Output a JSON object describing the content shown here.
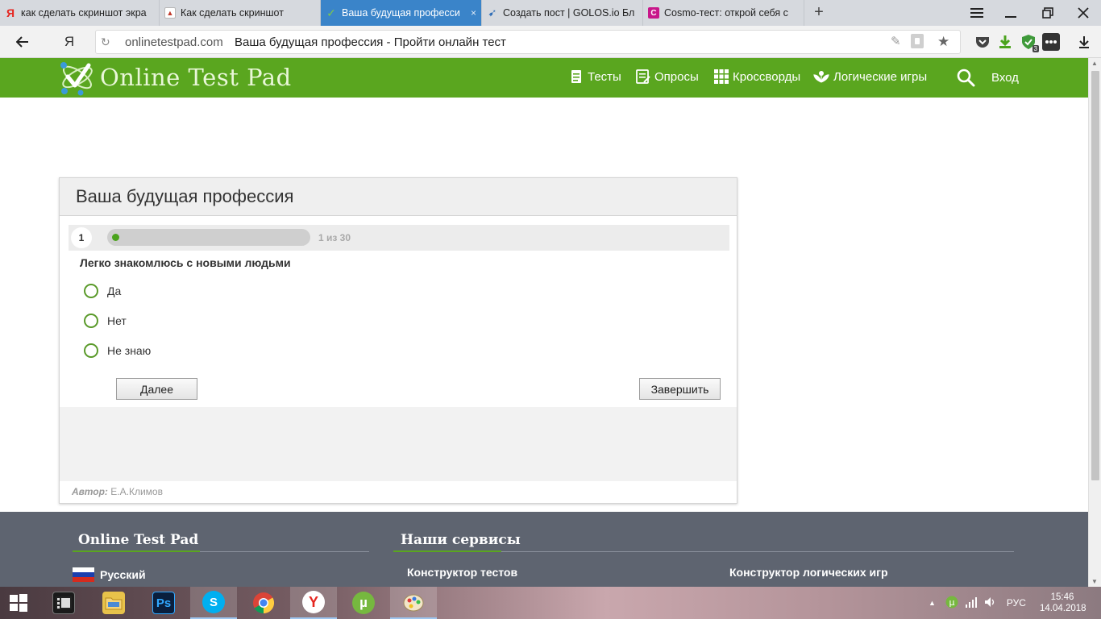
{
  "browser": {
    "tabs": [
      {
        "title": "как сделать скриншот экра",
        "favicon": "yandex-icon",
        "active": false
      },
      {
        "title": "Как сделать скриншот",
        "favicon": "document-icon",
        "active": false
      },
      {
        "title": "Ваша будущая професси",
        "favicon": "onlinetestpad-icon",
        "active": true
      },
      {
        "title": "Создать пост | GOLOS.io Бл",
        "favicon": "golos-icon",
        "active": false
      },
      {
        "title": "Cosmo-тест: открой себя с",
        "favicon": "cosmo-icon",
        "active": false
      }
    ],
    "tab_close_glyph": "×",
    "new_tab_glyph": "+",
    "yandex_button": "Я",
    "address": {
      "domain": "onlinetestpad.com",
      "title": "Ваша будущая профессия - Пройти онлайн тест"
    },
    "extension_badge": "3"
  },
  "site": {
    "logo": "Online Test Pad",
    "nav": [
      {
        "label": "Тесты",
        "icon": "document-icon"
      },
      {
        "label": "Опросы",
        "icon": "poll-icon"
      },
      {
        "label": "Кроссворды",
        "icon": "grid-icon"
      },
      {
        "label": "Логические игры",
        "icon": "puzzle-icon"
      }
    ],
    "login": "Вход",
    "accent_color": "#5aa61f"
  },
  "test": {
    "title": "Ваша будущая профессия",
    "question_number": "1",
    "progress_text": "1 из 30",
    "progress_fraction": 0.0333,
    "question": "Легко знакомлюсь с новыми людьми",
    "answers": [
      "Да",
      "Нет",
      "Не знаю"
    ],
    "next_button": "Далее",
    "finish_button": "Завершить",
    "author_label": "Автор:",
    "author_name": "Е.А.Климов"
  },
  "footer": {
    "brand": "Online Test Pad",
    "services_title": "Наши сервисы",
    "language": "Русский",
    "links": [
      "Конструктор тестов",
      "Конструктор логических игр"
    ]
  },
  "taskbar": {
    "apps": [
      "file-explorer-icon",
      "photoshop-icon",
      "skype-icon",
      "chrome-icon",
      "yandex-browser-icon",
      "utorrent-icon",
      "paint-icon"
    ],
    "language": "РУС",
    "time": "15:46",
    "date": "14.04.2018"
  }
}
